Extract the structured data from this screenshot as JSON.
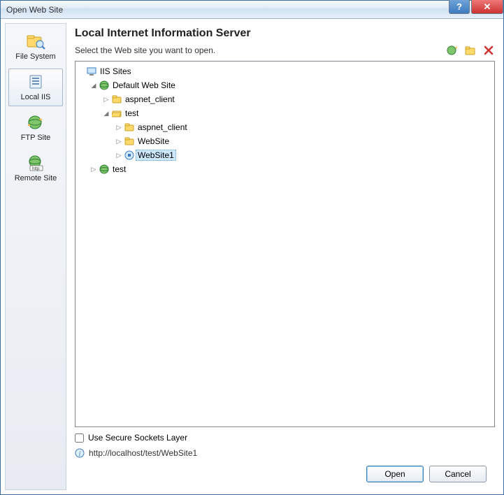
{
  "window": {
    "title": "Open Web Site"
  },
  "sidebar": {
    "items": [
      {
        "label": "File System",
        "icon": "folder-magnifier-icon",
        "selected": false
      },
      {
        "label": "Local IIS",
        "icon": "server-icon",
        "selected": true
      },
      {
        "label": "FTP Site",
        "icon": "globe-arrows-icon",
        "selected": false
      },
      {
        "label": "Remote Site",
        "icon": "globe-http-icon",
        "selected": false
      }
    ]
  },
  "main": {
    "heading": "Local Internet Information Server",
    "subtitle": "Select the Web site you want to open.",
    "toolbar": {
      "new_vdir_tooltip": "Create New Virtual Directory",
      "new_site_tooltip": "Create New Web Application",
      "delete_tooltip": "Delete"
    },
    "tree": [
      {
        "indent": 0,
        "expander": "",
        "icon": "computer-icon",
        "label": "IIS Sites"
      },
      {
        "indent": 1,
        "expander": "expanded",
        "icon": "globe-icon",
        "label": "Default Web Site"
      },
      {
        "indent": 2,
        "expander": "collapsed",
        "icon": "folder-icon",
        "label": "aspnet_client"
      },
      {
        "indent": 2,
        "expander": "expanded",
        "icon": "folder-open-icon",
        "label": "test"
      },
      {
        "indent": 3,
        "expander": "collapsed",
        "icon": "folder-icon",
        "label": "aspnet_client"
      },
      {
        "indent": 3,
        "expander": "collapsed",
        "icon": "folder-icon",
        "label": "WebSite"
      },
      {
        "indent": 3,
        "expander": "collapsed",
        "icon": "app-icon",
        "label": "WebSite1",
        "selected": true
      },
      {
        "indent": 1,
        "expander": "collapsed",
        "icon": "globe-icon",
        "label": "test"
      }
    ],
    "ssl_label": "Use Secure Sockets Layer",
    "ssl_checked": false,
    "url": "http://localhost/test/WebSite1"
  },
  "buttons": {
    "open": "Open",
    "cancel": "Cancel"
  }
}
